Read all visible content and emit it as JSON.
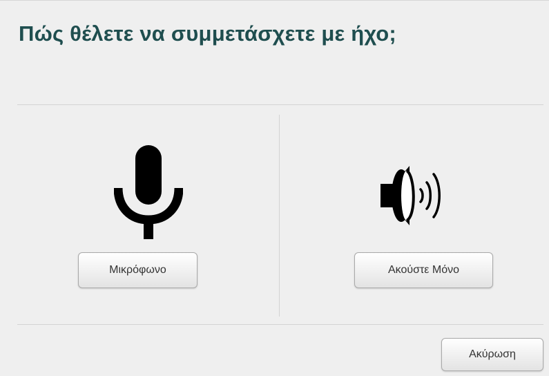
{
  "dialog": {
    "title": "Πώς θέλετε να συμμετάσχετε με ήχο;",
    "options": {
      "microphone": {
        "label": "Μικρόφωνο",
        "icon": "microphone-icon"
      },
      "listen_only": {
        "label": "Ακούστε Μόνο",
        "icon": "speaker-icon"
      }
    },
    "cancel_label": "Ακύρωση"
  },
  "colors": {
    "title": "#1f4e4f",
    "background": "#efefef",
    "icon": "#000000"
  }
}
